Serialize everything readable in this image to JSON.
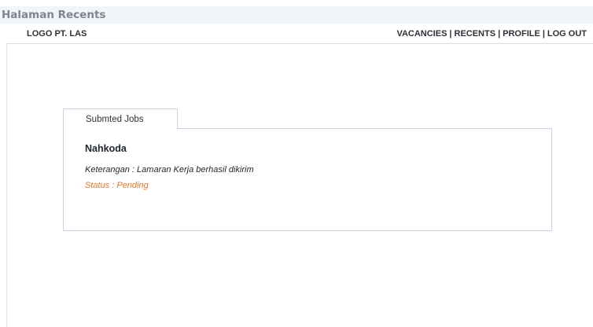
{
  "page_label": "Halaman Recents",
  "navbar": {
    "brand": "LOGO PT. LAS",
    "links": [
      "VACANCIES",
      "RECENTS",
      "PROFILE",
      "LOG OUT"
    ],
    "separator": "|"
  },
  "jobs_panel": {
    "tab_label": "Submted Jobs",
    "job": {
      "title": "Nahkoda",
      "description": "Keterangan : Lamaran Kerja berhasil dikirim",
      "status": "Status : Pending"
    }
  },
  "colors": {
    "status": "#e8772e",
    "border": "#c9d5e4",
    "header_band": "#f1f4f8"
  }
}
